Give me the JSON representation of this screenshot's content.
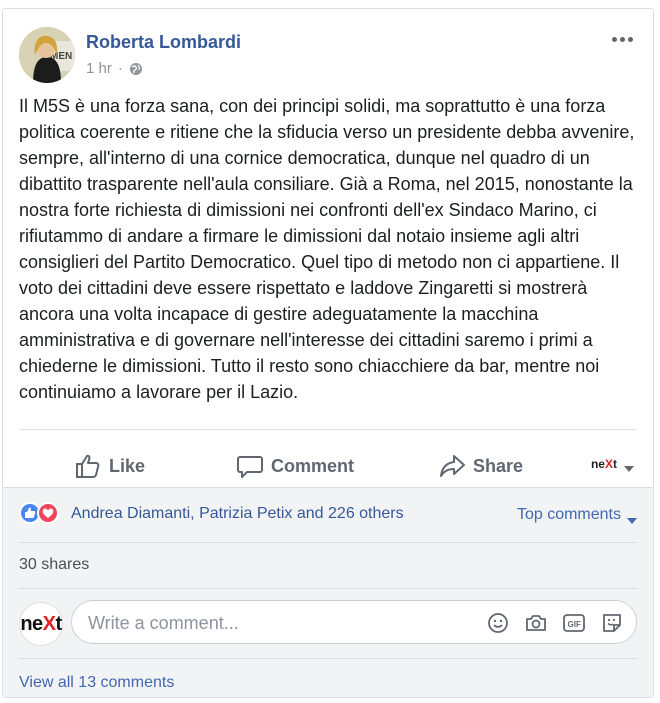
{
  "post": {
    "author": "Roberta Lombardi",
    "time": "1 hr",
    "privacy_icon": "globe-icon",
    "avatar_text": "MOVIMEN",
    "text": "Il M5S è una forza sana, con dei principi solidi, ma soprattutto è una forza politica coerente e ritiene che la sfiducia verso un presidente debba avvenire, sempre, all'interno di una cornice democratica, dunque nel quadro di un dibattito trasparente nell'aula consiliare. Già a Roma, nel 2015, nonostante la nostra forte richiesta di dimissioni nei confronti dell'ex Sindaco Marino, ci rifiutammo di andare a firmare le dimissioni dal notaio insieme agli altri consiglieri del Partito Democratico. Quel tipo di metodo non ci appartiene. Il voto dei cittadini deve essere rispettato e laddove Zingaretti si mostrerà ancora una volta incapace di gestire adeguatamente la macchina amministrativa e di governare nell'interesse dei cittadini saremo i primi a chiederne le dimissioni. Tutto il resto sono chiacchiere da bar, mentre noi continuiamo a lavorare per il Lazio."
  },
  "actions": {
    "like": "Like",
    "comment": "Comment",
    "share": "Share",
    "page_switch": "neXt"
  },
  "reactions": {
    "summary": "Andrea Diamanti, Patrizia Petix and 226 others",
    "types": [
      "like",
      "love"
    ],
    "sort_label": "Top comments"
  },
  "shares": "30 shares",
  "composer": {
    "placeholder": "Write a comment...",
    "page_logo": "neXt",
    "icons": [
      "emoji-icon",
      "camera-icon",
      "gif-icon",
      "sticker-icon"
    ]
  },
  "view_all": "View all 13 comments",
  "colors": {
    "link": "#365899",
    "action_blue": "#4267b2",
    "muted": "#606770",
    "next_red": "#e02020"
  }
}
